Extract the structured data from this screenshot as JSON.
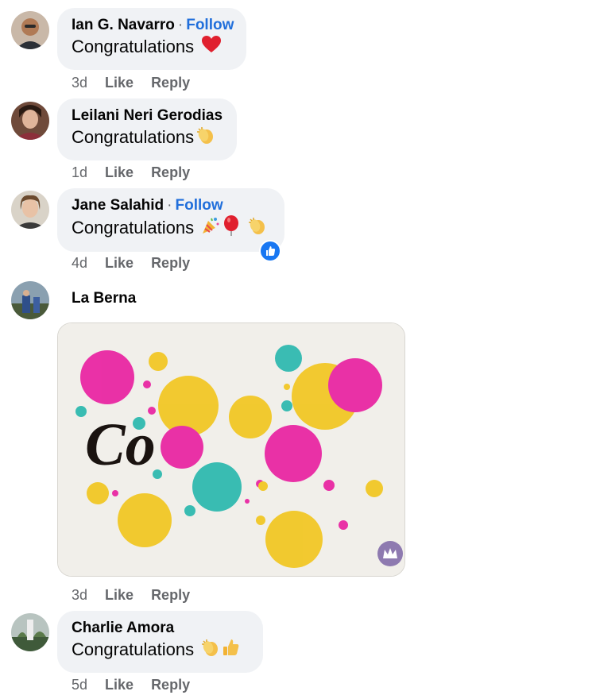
{
  "comments": [
    {
      "author": "Ian G. Navarro",
      "dot": "·",
      "follow": "Follow",
      "text": "Congratulations",
      "emojis": [
        "red-heart"
      ],
      "time": "3d",
      "like": "Like",
      "reply": "Reply"
    },
    {
      "author": "Leilani Neri Gerodias",
      "text": "Congratulations",
      "emojis": [
        "clapping-hands"
      ],
      "time": "1d",
      "like": "Like",
      "reply": "Reply"
    },
    {
      "author": "Jane Salahid",
      "dot": "·",
      "follow": "Follow",
      "text": "Congratulations",
      "emojis": [
        "party-popper",
        "balloon",
        "clapping-hands"
      ],
      "reaction": "like",
      "time": "4d",
      "like": "Like",
      "reply": "Reply"
    },
    {
      "author": "La Berna",
      "sticker": {
        "text": "Co",
        "colors": {
          "pink": "#e8179d",
          "yellow": "#f2c416",
          "teal": "#20b5ab",
          "background": "#f1efea"
        }
      },
      "time": "3d",
      "like": "Like",
      "reply": "Reply"
    },
    {
      "author": "Charlie Amora",
      "text": "Congratulations",
      "emojis": [
        "clapping-hands",
        "thumbs-up"
      ],
      "time": "5d",
      "like": "Like",
      "reply": "Reply"
    }
  ],
  "colors": {
    "bubble": "#f0f2f5",
    "follow": "#216fdb",
    "meta": "#65676b",
    "like_badge": "#1877f2"
  }
}
